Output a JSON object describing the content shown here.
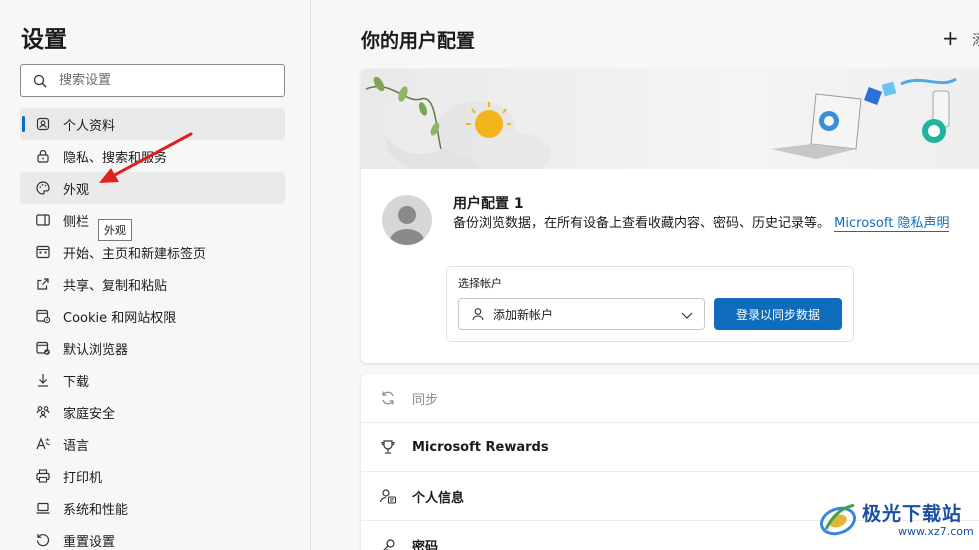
{
  "sidebar": {
    "title": "设置",
    "search_placeholder": "搜索设置",
    "items": [
      {
        "label": "个人资料",
        "icon": "profile-icon"
      },
      {
        "label": "隐私、搜索和服务",
        "icon": "lock-icon"
      },
      {
        "label": "外观",
        "icon": "palette-icon"
      },
      {
        "label": "侧栏",
        "icon": "sidebar-icon"
      },
      {
        "label": "开始、主页和新建标签页",
        "icon": "home-page-icon"
      },
      {
        "label": "共享、复制和粘贴",
        "icon": "share-icon"
      },
      {
        "label": "Cookie 和网站权限",
        "icon": "site-permissions-icon"
      },
      {
        "label": "默认浏览器",
        "icon": "default-browser-icon"
      },
      {
        "label": "下载",
        "icon": "download-icon"
      },
      {
        "label": "家庭安全",
        "icon": "family-icon"
      },
      {
        "label": "语言",
        "icon": "language-icon"
      },
      {
        "label": "打印机",
        "icon": "printer-icon"
      },
      {
        "label": "系统和性能",
        "icon": "laptop-icon"
      },
      {
        "label": "重置设置",
        "icon": "reset-icon"
      }
    ],
    "active_index": 0,
    "hover_index": 2,
    "tooltip": "外观"
  },
  "main": {
    "title": "你的用户配置",
    "add_icon": "plus-icon",
    "add_text": "添",
    "profile": {
      "name": "用户配置 1",
      "description": "备份浏览数据，在所有设备上查看收藏内容、密码、历史记录等。",
      "privacy_link": "Microsoft 隐私声明",
      "account_label": "选择帐户",
      "account_select": "添加新帐户",
      "sync_button": "登录以同步数据"
    },
    "rows": [
      {
        "label": "同步",
        "icon": "sync-icon",
        "style": "muted"
      },
      {
        "label": "Microsoft Rewards",
        "icon": "trophy-icon",
        "style": "bold"
      },
      {
        "label": "个人信息",
        "icon": "personal-info-icon",
        "style": "bold"
      },
      {
        "label": "密码",
        "icon": "key-icon",
        "style": "bold"
      }
    ]
  },
  "watermark": {
    "text": "极光下载站",
    "url": "www.xz7.com"
  },
  "colors": {
    "accent": "#0f6cbd",
    "annotation_arrow": "#e02020"
  }
}
